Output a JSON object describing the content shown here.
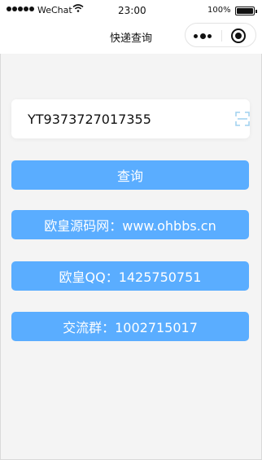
{
  "status_bar": {
    "carrier": "WeChat",
    "time": "23:00",
    "battery": "100%"
  },
  "navbar": {
    "title": "快递查询"
  },
  "search": {
    "tracking_number": "YT9373727017355",
    "scan_icon": "scan-icon"
  },
  "buttons": {
    "query": "查询",
    "line1": "欧皇源码网：www.ohbbs.cn",
    "line2": "欧皇QQ：1425750751",
    "line3": "交流群：1002715017"
  },
  "colors": {
    "accent": "#5aadff",
    "background": "#f4f4f4",
    "scan_icon": "#9fd0ef"
  }
}
